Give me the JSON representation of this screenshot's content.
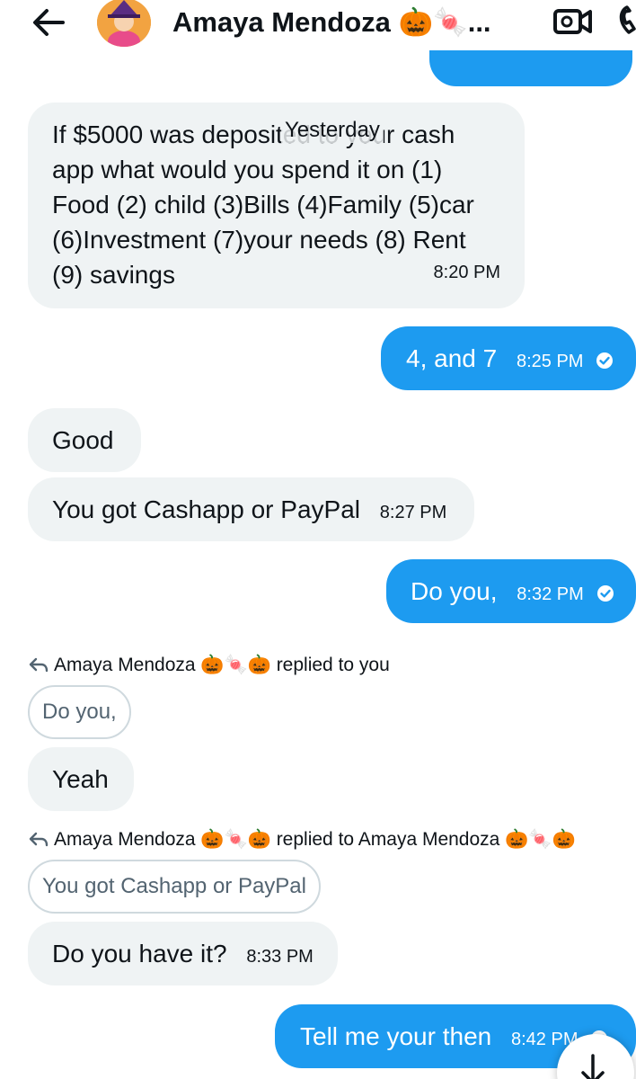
{
  "header": {
    "title": "Amaya Mendoza 🎃🍬...",
    "back_icon": "arrow-left-icon",
    "video_icon": "video-camera-icon",
    "phone_icon": "phone-icon"
  },
  "colors": {
    "outgoing_bubble": "#1d9bf0",
    "incoming_bubble": "#eff3f4",
    "quote_border": "#cfd9de"
  },
  "date_divider": "Yesterday",
  "messages": [
    {
      "direction": "incoming",
      "text": "If $5000 was deposited to your cash\napp what would you spend it on  (1)\nFood  (2) child (3)Bills (4)Family (5)car\n(6)Investment  (7)your needs (8) Rent\n(9) savings",
      "time": "8:20 PM"
    },
    {
      "direction": "outgoing",
      "text": "4, and 7",
      "time": "8:25 PM",
      "status": "read"
    },
    {
      "direction": "incoming",
      "text": "Good"
    },
    {
      "direction": "incoming",
      "text": "You got Cashapp or PayPal",
      "time": "8:27 PM"
    },
    {
      "direction": "outgoing",
      "text": "Do you,",
      "time": "8:32 PM",
      "status": "read"
    },
    {
      "direction": "incoming",
      "reply_header": "Amaya Mendoza 🎃🍬🎃 replied to you",
      "quoted": "Do you,",
      "text": "Yeah"
    },
    {
      "direction": "incoming",
      "reply_header": "Amaya Mendoza 🎃🍬🎃 replied to Amaya Mendoza 🎃🍬🎃",
      "quoted": "You got Cashapp or PayPal",
      "text": "Do you have it?",
      "time": "8:33 PM"
    },
    {
      "direction": "outgoing",
      "text": "Tell me your then",
      "time": "8:42 PM",
      "status": "read"
    }
  ],
  "scroll_button_icon": "arrow-down-icon"
}
